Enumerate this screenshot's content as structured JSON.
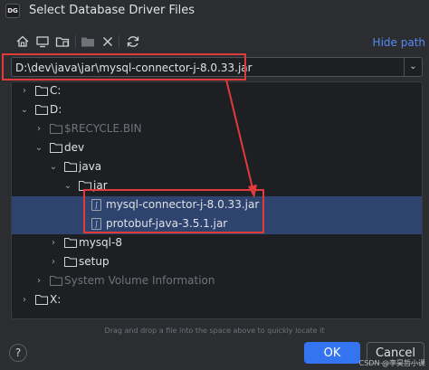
{
  "window": {
    "title": "Select Database Driver Files",
    "app_icon": "DG"
  },
  "toolbar": {
    "icons": [
      "home-icon",
      "desktop-icon",
      "project-folder-icon",
      "new-folder-icon",
      "delete-icon",
      "refresh-icon"
    ],
    "hide_path": "Hide path"
  },
  "path": {
    "value": "D:\\dev\\java\\jar\\mysql-connector-j-8.0.33.jar"
  },
  "tree": {
    "c_drive": "C:",
    "d_drive": "D:",
    "recycle_bin": "$RECYCLE.BIN",
    "dev": "dev",
    "java": "java",
    "jar": "jar",
    "file_mysql": "mysql-connector-j-8.0.33.jar",
    "file_protobuf": "protobuf-java-3.5.1.jar",
    "mysql8": "mysql-8",
    "setup": "setup",
    "system_volume": "System Volume Information",
    "x_drive": "X:"
  },
  "hint": "Drag and drop a file into the space above to quickly locate it",
  "buttons": {
    "help": "?",
    "ok": "OK",
    "cancel": "Cancel"
  },
  "watermark": "CSDN @李昊哲小课",
  "colors": {
    "accent": "#3574f0",
    "selection": "#2e436e",
    "annotation": "#e03b3b",
    "link": "#548af7"
  }
}
